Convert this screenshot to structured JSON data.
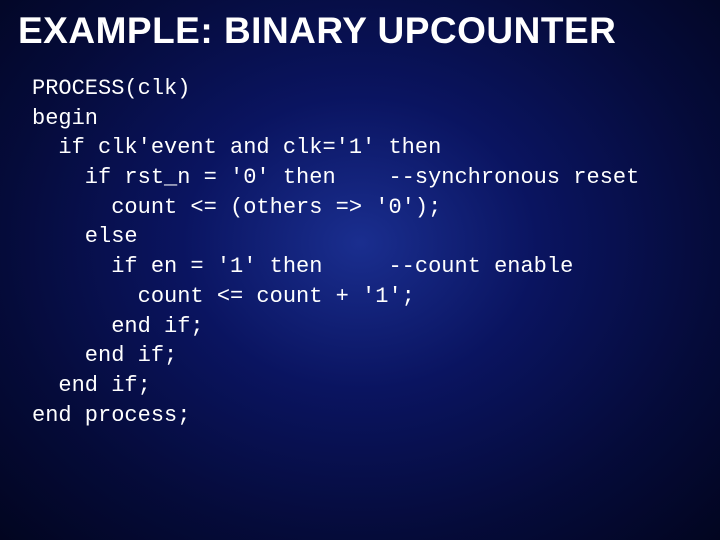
{
  "slide": {
    "title": "EXAMPLE: BINARY UPCOUNTER",
    "code": "PROCESS(clk)\nbegin\n  if clk'event and clk='1' then\n    if rst_n = '0' then    --synchronous reset\n      count <= (others => '0');\n    else\n      if en = '1' then     --count enable\n        count <= count + '1';\n      end if;\n    end if;\n  end if;\nend process;"
  }
}
